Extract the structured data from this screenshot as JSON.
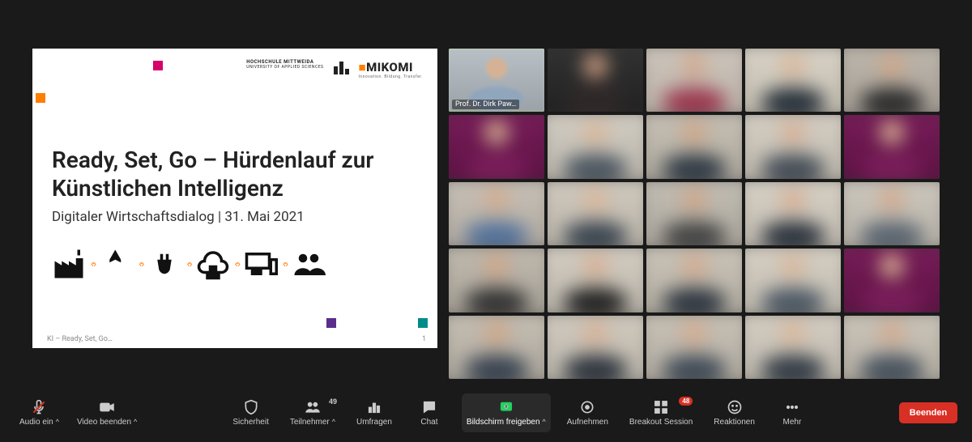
{
  "slide": {
    "university_name": "HOCHSCHULE\nMITTWEIDA",
    "university_sub": "UNIVERSITY OF\nAPPLIED SCIENCES",
    "mikomi_name": "MIKOMI",
    "mikomi_sub": "Innovation. Bildung. Transfer.",
    "title": "Ready, Set, Go – Hürdenlauf zur Künstlichen Intelligenz",
    "subtitle": "Digitaler Wirtschaftsdialog | 31. Mai 2021",
    "footer": "KI – Ready, Set, Go…",
    "page_number": "1"
  },
  "gallery": {
    "speaker_name": "Prof. Dr. Dirk Paw…",
    "tiles": [
      {
        "bg": "#b9c1c7",
        "bg2": "#9aa2a8",
        "skin": "#d5b295",
        "shirt": "#90a6bd",
        "speaker": true
      },
      {
        "bg": "#343434",
        "bg2": "#1f1f1f",
        "skin": "#c79a80",
        "shirt": "#302828"
      },
      {
        "bg": "#cfc7bd",
        "bg2": "#b7afa5",
        "skin": "#d2a98f",
        "shirt": "#9a374f"
      },
      {
        "bg": "#d9d3c8",
        "bg2": "#c2bcae",
        "skin": "#d9b79b",
        "shirt": "#26303a"
      },
      {
        "bg": "#bfb8ae",
        "bg2": "#a59e94",
        "skin": "#cfa688",
        "shirt": "#2c2c2c"
      },
      {
        "bg": "#7a1d5a",
        "bg2": "#5a1142",
        "skin": "#d2a98f",
        "shirt": "#7a1d5a"
      },
      {
        "bg": "#d3cec4",
        "bg2": "#b9b4aa",
        "skin": "#d9b79b",
        "shirt": "#4a5560"
      },
      {
        "bg": "#c7c1b6",
        "bg2": "#ada79c",
        "skin": "#cfa688",
        "shirt": "#2f3a44"
      },
      {
        "bg": "#d6d0c5",
        "bg2": "#bcb6ab",
        "skin": "#d7b095",
        "shirt": "#434c56"
      },
      {
        "bg": "#7a1d5a",
        "bg2": "#5a1142",
        "skin": "#d2a98f",
        "shirt": "#7a1d5a"
      },
      {
        "bg": "#c9c2b8",
        "bg2": "#afa89e",
        "skin": "#d3ab8f",
        "shirt": "#52719a"
      },
      {
        "bg": "#d1cbc0",
        "bg2": "#b7b1a6",
        "skin": "#d9b79b",
        "shirt": "#3a4550"
      },
      {
        "bg": "#c4bfb5",
        "bg2": "#aaa59b",
        "skin": "#cfa688",
        "shirt": "#444"
      },
      {
        "bg": "#d8d2c7",
        "bg2": "#beb8ad",
        "skin": "#d7b095",
        "shirt": "#2b333c"
      },
      {
        "bg": "#cec9bf",
        "bg2": "#b4afa5",
        "skin": "#d2a98f",
        "shirt": "#5a6570"
      },
      {
        "bg": "#c1bbb0",
        "bg2": "#a7a196",
        "skin": "#cfa688",
        "shirt": "#333"
      },
      {
        "bg": "#d4cec3",
        "bg2": "#bab4a9",
        "skin": "#d7b095",
        "shirt": "#222"
      },
      {
        "bg": "#cbc5ba",
        "bg2": "#b1ab9f",
        "skin": "#d3ab8f",
        "shirt": "#2e3640"
      },
      {
        "bg": "#d7d1c6",
        "bg2": "#bdb7ac",
        "skin": "#d9b79b",
        "shirt": "#4b5763"
      },
      {
        "bg": "#7a1d5a",
        "bg2": "#5a1142",
        "skin": "#d2a98f",
        "shirt": "#7a1d5a"
      },
      {
        "bg": "#c6c0b5",
        "bg2": "#aca69b",
        "skin": "#cfa688",
        "shirt": "#374250"
      },
      {
        "bg": "#d2ccc1",
        "bg2": "#b8b2a7",
        "skin": "#d7b095",
        "shirt": "#2d343d"
      },
      {
        "bg": "#c9c3b8",
        "bg2": "#afa99e",
        "skin": "#d3ab8f",
        "shirt": "#3f4a56"
      },
      {
        "bg": "#d5cfc4",
        "bg2": "#bbb5aa",
        "skin": "#d9b79b",
        "shirt": "#323b45"
      },
      {
        "bg": "#ccc6bb",
        "bg2": "#b2aca1",
        "skin": "#d2a98f",
        "shirt": "#46515d"
      }
    ]
  },
  "toolbar": {
    "audio_label": "Audio ein",
    "video_label": "Video beenden",
    "security_label": "Sicherheit",
    "participants_label": "Teilnehmer",
    "participants_count": "49",
    "polls_label": "Umfragen",
    "chat_label": "Chat",
    "share_label": "Bildschirm freigeben",
    "record_label": "Aufnehmen",
    "breakout_label": "Breakout Session",
    "breakout_badge": "48",
    "reactions_label": "Reaktionen",
    "more_label": "Mehr",
    "end_label": "Beenden"
  }
}
